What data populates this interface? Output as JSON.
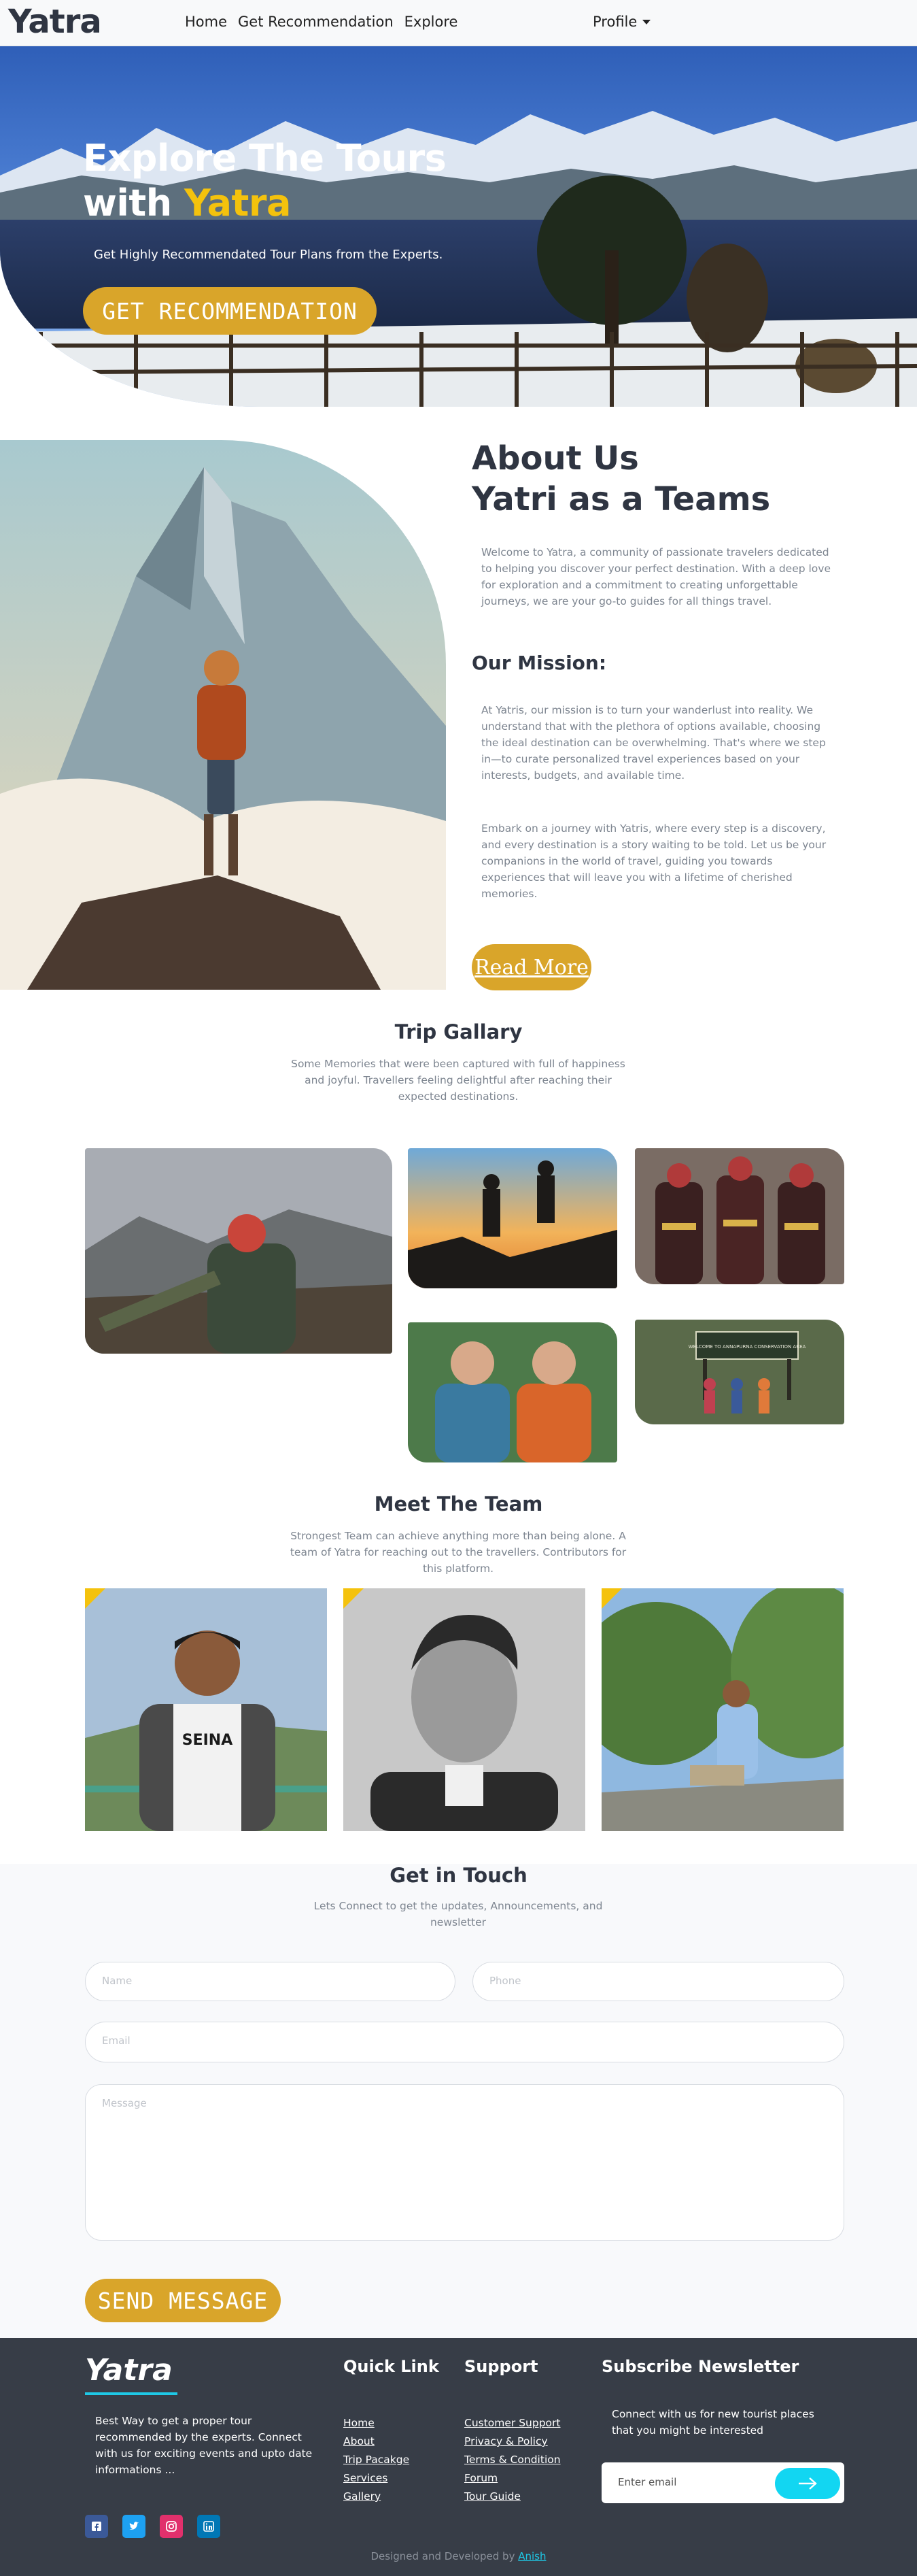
{
  "navbar": {
    "brand": "Yatra",
    "links": [
      "Home",
      "Get Recommendation",
      "Explore"
    ],
    "profile": "Profile"
  },
  "hero": {
    "title_line1": "Explore The Tours",
    "title_with": "with",
    "title_accent": "Yatra",
    "subtitle": "Get Highly Recommendated Tour Plans from the Experts.",
    "button": "GET RECOMMENDATION"
  },
  "about": {
    "title_line1": "About Us",
    "title_line2": "Yatri as a Teams",
    "intro": "Welcome to Yatra, a community of passionate travelers dedicated to helping you discover your perfect destination. With a deep love for exploration and a commitment to creating unforgettable journeys, we are your go-to guides for all things travel.",
    "mission_title": "Our Mission:",
    "mission_p1": "At Yatris, our mission is to turn your wanderlust into reality. We understand that with the plethora of options available, choosing the ideal destination can be overwhelming. That's where we step in—to curate personalized travel experiences based on your interests, budgets, and available time.",
    "mission_p2": "Embark on a journey with Yatris, where every step is a discovery, and every destination is a story waiting to be told. Let us be your companions in the world of travel, guiding you towards experiences that will leave you with a lifetime of cherished memories.",
    "read_more": "Read More"
  },
  "gallery": {
    "title": "Trip Gallary",
    "subtitle": "Some Memories that were been captured with full of happiness and joyful. Travellers feeling delightful after reaching their expected destinations.",
    "sign_text": "WELCOME TO ANNAPURNA CONSERVATION AREA"
  },
  "team": {
    "title": "Meet The Team",
    "subtitle": "Strongest Team can achieve anything more than being alone. A team of Yatra for reaching out to the travellers. Contributors for this platform.",
    "shirt_text": "SEINA"
  },
  "contact": {
    "title": "Get in Touch",
    "subtitle": "Lets Connect to get the updates, Announcements, and newsletter",
    "name_placeholder": "Name",
    "phone_placeholder": "Phone",
    "email_placeholder": "Email",
    "message_placeholder": "Message",
    "send": "SEND MESSAGE"
  },
  "footer": {
    "brand": "Yatra",
    "description": "Best Way to get a proper tour recommended by the experts. Connect with us for exciting events and upto date informations ...",
    "quick_title": "Quick Link",
    "quick_links": [
      "Home",
      "About",
      "Trip Pacakge",
      "Services",
      "Gallery"
    ],
    "support_title": "Support",
    "support_links": [
      "Customer Support",
      "Privacy & Policy",
      "Terms & Condition",
      "Forum",
      "Tour Guide"
    ],
    "newsletter_title": "Subscribe Newsletter",
    "newsletter_text": "Connect with us for new tourist places that you might be interested",
    "newsletter_placeholder": "Enter email",
    "credit_prefix": "Designed and Developed by",
    "credit_author": "Anish",
    "social_icons": [
      "facebook-icon",
      "twitter-icon",
      "instagram-icon",
      "linkedin-icon"
    ],
    "colors": {
      "facebook": "#3b5998",
      "twitter": "#1da1f2",
      "instagram": "#e1306c",
      "linkedin": "#0077b5"
    }
  },
  "colors": {
    "accent": "#d9a52a",
    "accent_yellow": "#f4c20d",
    "dark": "#2f3542",
    "footer_bg": "#373d47",
    "cyan": "#12d6f2"
  }
}
